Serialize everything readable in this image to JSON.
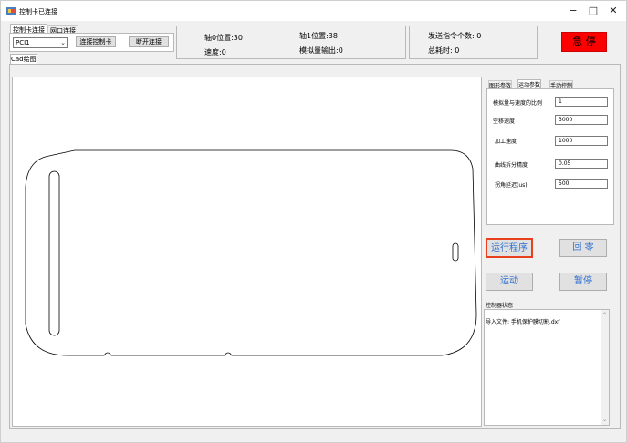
{
  "window": {
    "title": "控制卡已连接",
    "minimize": "−",
    "maximize": "□",
    "close": "✕"
  },
  "connection_tabs": [
    "控制卡连接",
    "网口连接"
  ],
  "connection": {
    "port_value": "PCI1",
    "connect_button": "连接控制卡",
    "disconnect_button": "断开连接"
  },
  "status": {
    "axis0_label": "轴0位置:",
    "axis0_value": "30",
    "axis1_label": "轴1位置:",
    "axis1_value": "38",
    "speed_label": "速度:",
    "speed_value": "0",
    "analog_label": "模拟量输出:",
    "analog_value": "0",
    "sent_label": "发送指令个数:",
    "sent_value": "0",
    "time_label": "总耗时:",
    "time_value": "0"
  },
  "estop_label": "急 停",
  "cad_tab": "Cad绘图",
  "param_tabs": [
    "图形参数",
    "运动参数",
    "手动控制"
  ],
  "params": [
    {
      "label": "模拟量与速度的比例",
      "value": "1"
    },
    {
      "label": "空移速度",
      "value": "3000"
    },
    {
      "label": "加工速度",
      "value": "1000"
    },
    {
      "label": "曲线拆分精度",
      "value": "0.05"
    },
    {
      "label": "拐角延迟(us)",
      "value": "500"
    }
  ],
  "buttons": {
    "run_program": "运行程序",
    "home": "回 零",
    "motion": "运动",
    "pause": "暂停"
  },
  "controller_status": {
    "label": "控制器状态",
    "log_text": "导入文件: 手机保护膜切割.dxf"
  },
  "colors": {
    "estop": "#ff0000",
    "run_highlight": "#e8401c",
    "button_text": "#2f6fd0"
  }
}
